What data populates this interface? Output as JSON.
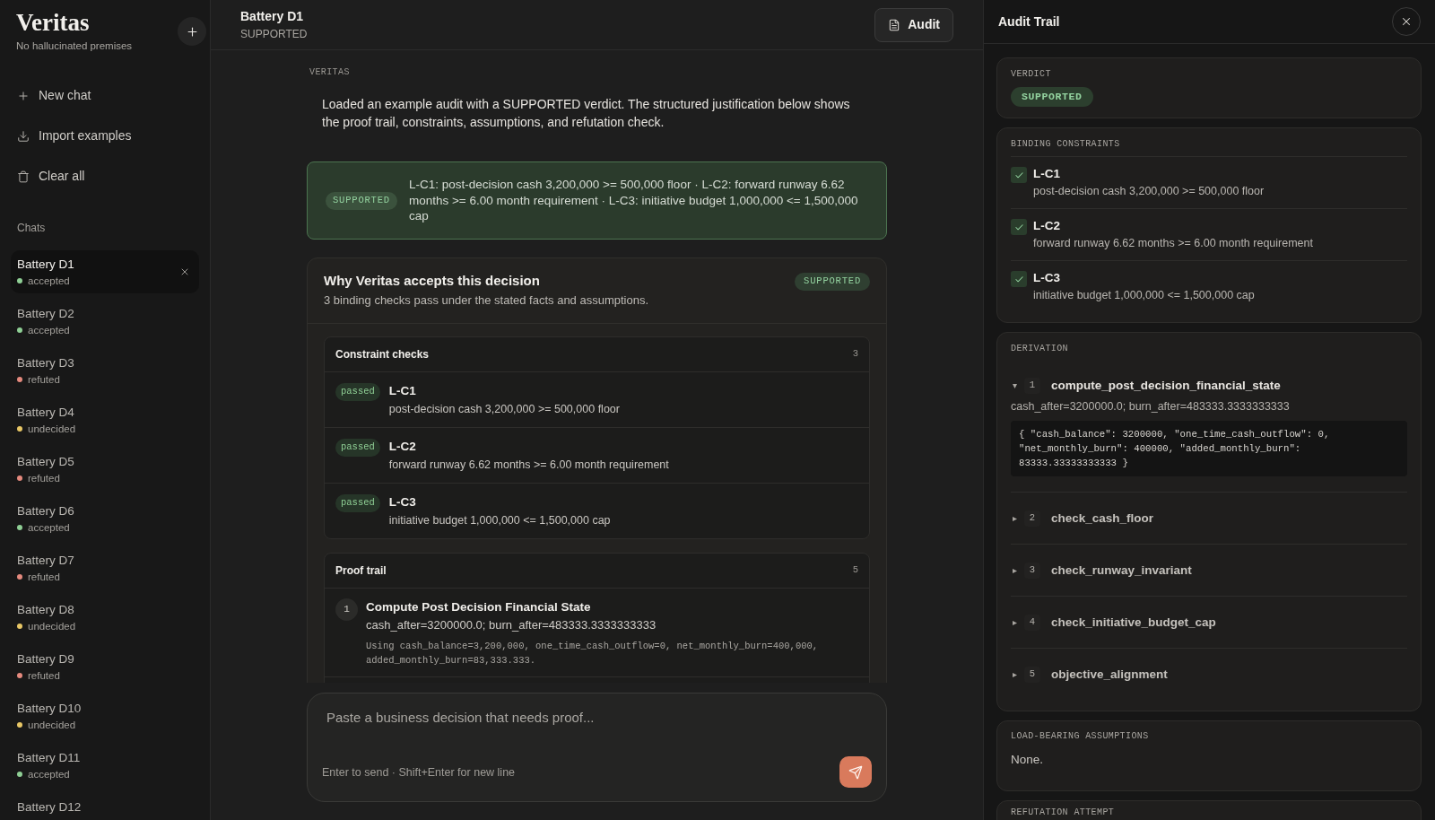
{
  "sidebar": {
    "logo": "Veritas",
    "tagline": "No hallucinated premises",
    "actions": [
      {
        "kind": "new",
        "label": "New chat"
      },
      {
        "kind": "import",
        "label": "Import examples"
      },
      {
        "kind": "clear",
        "label": "Clear all"
      }
    ],
    "chats_heading": "Chats",
    "chats": [
      {
        "title": "Battery D1",
        "status": "accepted",
        "color": "#8fcf95",
        "selected": true
      },
      {
        "title": "Battery D2",
        "status": "accepted",
        "color": "#8fcf95",
        "selected": false
      },
      {
        "title": "Battery D3",
        "status": "refuted",
        "color": "#e58a7e",
        "selected": false
      },
      {
        "title": "Battery D4",
        "status": "undecided",
        "color": "#e8c766",
        "selected": false
      },
      {
        "title": "Battery D5",
        "status": "refuted",
        "color": "#e58a7e",
        "selected": false
      },
      {
        "title": "Battery D6",
        "status": "accepted",
        "color": "#8fcf95",
        "selected": false
      },
      {
        "title": "Battery D7",
        "status": "refuted",
        "color": "#e58a7e",
        "selected": false
      },
      {
        "title": "Battery D8",
        "status": "undecided",
        "color": "#e8c766",
        "selected": false
      },
      {
        "title": "Battery D9",
        "status": "refuted",
        "color": "#e58a7e",
        "selected": false
      },
      {
        "title": "Battery D10",
        "status": "undecided",
        "color": "#e8c766",
        "selected": false
      },
      {
        "title": "Battery D11",
        "status": "accepted",
        "color": "#8fcf95",
        "selected": false
      },
      {
        "title": "Battery D12",
        "selected": false
      }
    ]
  },
  "header": {
    "title": "Battery D1",
    "subtitle": "SUPPORTED",
    "audit_button": "Audit"
  },
  "conversation": {
    "author": "VERITAS",
    "message": "Loaded an example audit with a SUPPORTED verdict. The structured justification below shows the proof trail, constraints, assumptions, and refutation check.",
    "verdict_banner": {
      "badge": "SUPPORTED",
      "summary": "L-C1: post-decision cash 3,200,000 >= 500,000 floor · L-C2: forward runway 6.62 months >= 6.00 month requirement · L-C3: initiative budget 1,000,000 <= 1,500,000 cap"
    },
    "justification": {
      "title": "Why Veritas accepts this decision",
      "subtitle": "3 binding checks pass under the stated facts and assumptions.",
      "badge": "SUPPORTED",
      "constraint_checks": {
        "title": "Constraint checks",
        "count": "3",
        "rows": [
          {
            "status": "passed",
            "id": "L-C1",
            "text": "post-decision cash 3,200,000 >= 500,000 floor"
          },
          {
            "status": "passed",
            "id": "L-C2",
            "text": "forward runway 6.62 months >= 6.00 month requirement"
          },
          {
            "status": "passed",
            "id": "L-C3",
            "text": "initiative budget 1,000,000 <= 1,500,000 cap"
          }
        ]
      },
      "proof_trail": {
        "title": "Proof trail",
        "count": "5",
        "steps": [
          {
            "number": "1",
            "title": "Compute Post Decision Financial State",
            "result": "cash_after=3200000.0; burn_after=483333.3333333333",
            "detail": "Using cash_balance=3,200,000, one_time_cash_outflow=0, net_monthly_burn=400,000, added_monthly_burn=83,333.333."
          }
        ]
      }
    }
  },
  "composer": {
    "placeholder": "Paste a business decision that needs proof...",
    "hint": "Enter to send · Shift+Enter for new line"
  },
  "audit_panel": {
    "title": "Audit Trail",
    "verdict": {
      "label": "VERDICT",
      "badge": "SUPPORTED"
    },
    "binding_constraints": {
      "label": "BINDING CONSTRAINTS",
      "items": [
        {
          "id": "L-C1",
          "text": "post-decision cash 3,200,000 >= 500,000 floor",
          "checked": true
        },
        {
          "id": "L-C2",
          "text": "forward runway 6.62 months >= 6.00 month requirement",
          "checked": true
        },
        {
          "id": "L-C3",
          "text": "initiative budget 1,000,000 <= 1,500,000 cap",
          "checked": true
        }
      ]
    },
    "derivation": {
      "label": "DERIVATION",
      "steps": [
        {
          "number": "1",
          "name": "compute_post_decision_financial_state",
          "expanded": true,
          "result": "cash_after=3200000.0; burn_after=483333.3333333333",
          "code": "{ \"cash_balance\": 3200000, \"one_time_cash_outflow\": 0, \"net_monthly_burn\": 400000, \"added_monthly_burn\": 83333.33333333333 }"
        },
        {
          "number": "2",
          "name": "check_cash_floor",
          "expanded": false
        },
        {
          "number": "3",
          "name": "check_runway_invariant",
          "expanded": false
        },
        {
          "number": "4",
          "name": "check_initiative_budget_cap",
          "expanded": false
        },
        {
          "number": "5",
          "name": "objective_alignment",
          "expanded": false
        }
      ]
    },
    "assumptions": {
      "label": "LOAD-BEARING ASSUMPTIONS",
      "text": "None."
    },
    "refutation": {
      "label": "REFUTATION ATTEMPT"
    }
  }
}
